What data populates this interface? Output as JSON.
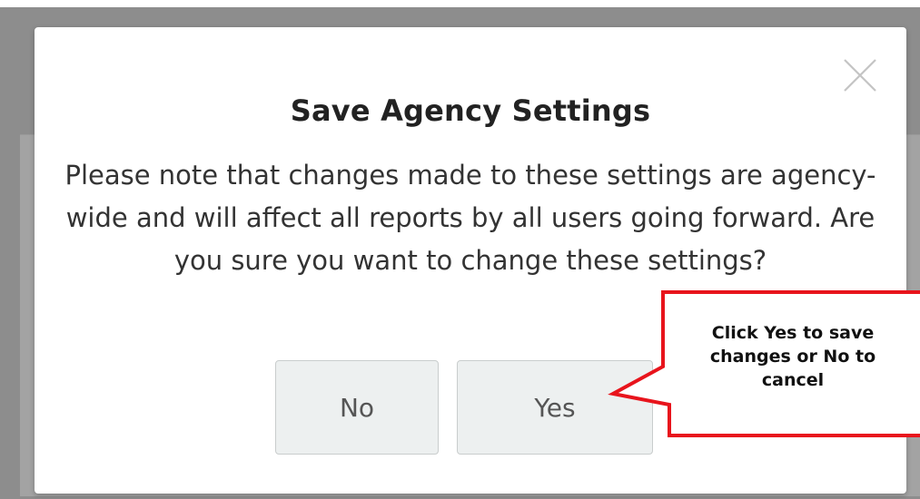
{
  "dialog": {
    "title": "Save Agency Settings",
    "message": "Please note that changes made to these settings are agency-wide and will affect all reports by all users going forward. Are you sure you want to change these settings?",
    "no_label": "No",
    "yes_label": "Yes",
    "close_icon": "close-icon"
  },
  "callout": {
    "text": "Click Yes to save changes or No to cancel",
    "border_color": "#e8141c"
  }
}
